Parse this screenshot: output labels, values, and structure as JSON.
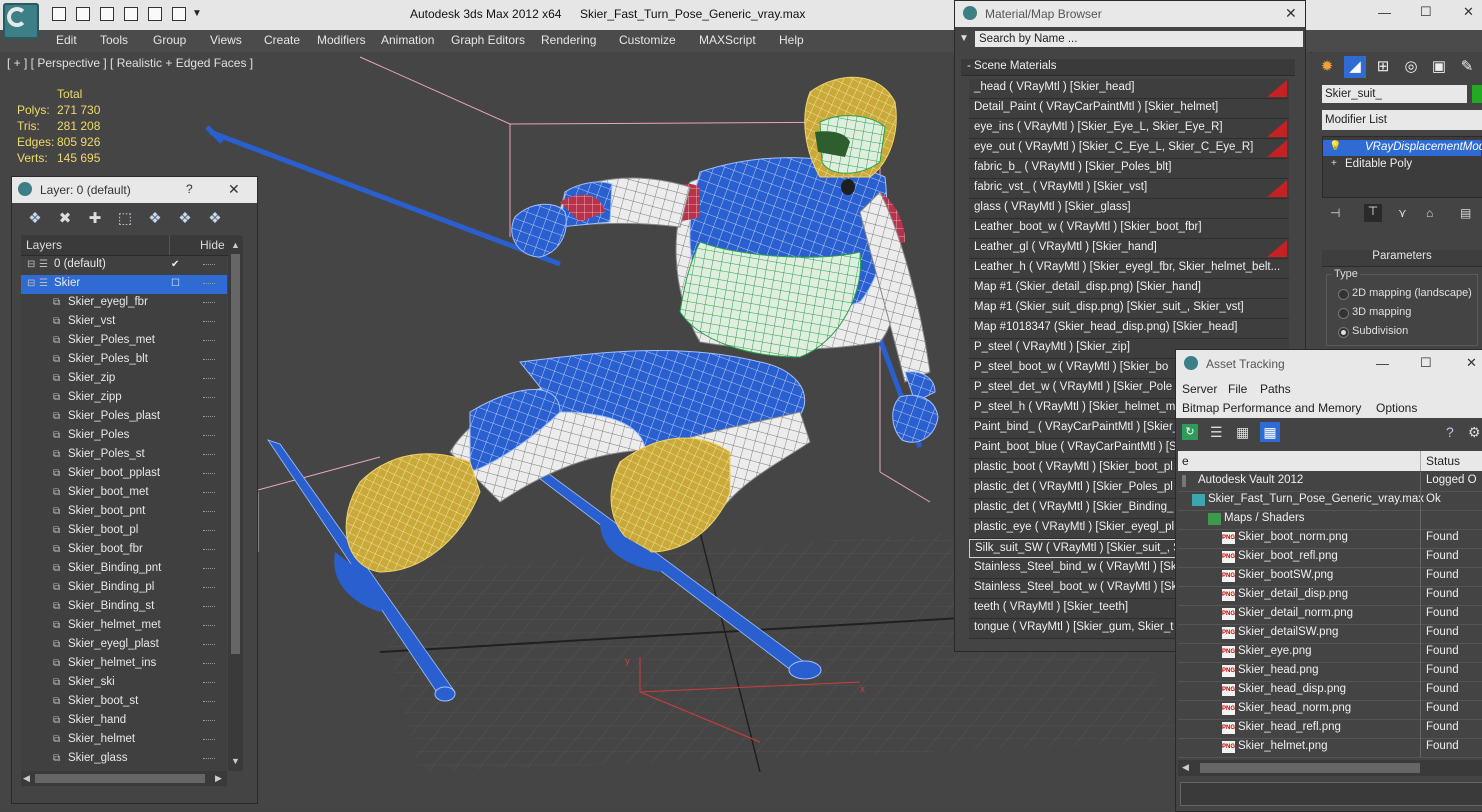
{
  "window": {
    "app_title": "Autodesk 3ds Max  2012 x64",
    "file_title": "Skier_Fast_Turn_Pose_Generic_vray.max"
  },
  "menu": [
    "Edit",
    "Tools",
    "Group",
    "Views",
    "Create",
    "Modifiers",
    "Animation",
    "Graph Editors",
    "Rendering",
    "Customize",
    "MAXScript",
    "Help"
  ],
  "viewport": {
    "label": "[ + ] [ Perspective ] [ Realistic + Edged Faces ]",
    "stats": {
      "header": "Total",
      "rows": [
        {
          "label": "Polys:",
          "value": "271 730"
        },
        {
          "label": "Tris:",
          "value": "281 208"
        },
        {
          "label": "Edges:",
          "value": "805 926"
        },
        {
          "label": "Verts:",
          "value": "145 695"
        }
      ]
    },
    "axis_x": "x",
    "axis_y": "y"
  },
  "layer_dialog": {
    "title": "Layer: 0 (default)",
    "help": "?",
    "close": "✕",
    "col_layers": "Layers",
    "col_hide": "Hide",
    "rows": [
      {
        "name": "0 (default)",
        "level": 1,
        "check": true
      },
      {
        "name": "Skier",
        "level": 1,
        "selected": true
      },
      {
        "name": "Skier_eyegl_fbr",
        "level": 2
      },
      {
        "name": "Skier_vst",
        "level": 2
      },
      {
        "name": "Skier_Poles_met",
        "level": 2
      },
      {
        "name": "Skier_Poles_blt",
        "level": 2
      },
      {
        "name": "Skier_zip",
        "level": 2
      },
      {
        "name": "Skier_zipp",
        "level": 2
      },
      {
        "name": "Skier_Poles_plast",
        "level": 2
      },
      {
        "name": "Skier_Poles",
        "level": 2
      },
      {
        "name": "Skier_Poles_st",
        "level": 2
      },
      {
        "name": "Skier_boot_pplast",
        "level": 2
      },
      {
        "name": "Skier_boot_met",
        "level": 2
      },
      {
        "name": "Skier_boot_pnt",
        "level": 2
      },
      {
        "name": "Skier_boot_pl",
        "level": 2
      },
      {
        "name": "Skier_boot_fbr",
        "level": 2
      },
      {
        "name": "Skier_Binding_pnt",
        "level": 2
      },
      {
        "name": "Skier_Binding_pl",
        "level": 2
      },
      {
        "name": "Skier_Binding_st",
        "level": 2
      },
      {
        "name": "Skier_helmet_met",
        "level": 2
      },
      {
        "name": "Skier_eyegl_plast",
        "level": 2
      },
      {
        "name": "Skier_helmet_ins",
        "level": 2
      },
      {
        "name": "Skier_ski",
        "level": 2
      },
      {
        "name": "Skier_boot_st",
        "level": 2
      },
      {
        "name": "Skier_hand",
        "level": 2
      },
      {
        "name": "Skier_helmet",
        "level": 2
      },
      {
        "name": "Skier_glass",
        "level": 2
      }
    ]
  },
  "material_browser": {
    "title": "Material/Map Browser",
    "close": "✕",
    "search_placeholder": "Search by Name ...",
    "group": "- Scene Materials",
    "rows": [
      {
        "text": "_head  ( VRayMtl ) [Skier_head]",
        "swatch": true
      },
      {
        "text": "Detail_Paint  ( VRayCarPaintMtl ) [Skier_helmet]",
        "swatch": false
      },
      {
        "text": "eye_ins  ( VRayMtl ) [Skier_Eye_L, Skier_Eye_R]",
        "swatch": true
      },
      {
        "text": "eye_out  ( VRayMtl ) [Skier_C_Eye_L, Skier_C_Eye_R]",
        "swatch": true
      },
      {
        "text": "fabric_b_  ( VRayMtl ) [Skier_Poles_blt]",
        "swatch": false
      },
      {
        "text": "fabric_vst_  ( VRayMtl ) [Skier_vst]",
        "swatch": true
      },
      {
        "text": "glass  ( VRayMtl ) [Skier_glass]",
        "swatch": false
      },
      {
        "text": "Leather_boot_w  ( VRayMtl ) [Skier_boot_fbr]",
        "swatch": false
      },
      {
        "text": "Leather_gl  ( VRayMtl ) [Skier_hand]",
        "swatch": true
      },
      {
        "text": "Leather_h  ( VRayMtl ) [Skier_eyegl_fbr, Skier_helmet_belt...",
        "swatch": false
      },
      {
        "text": "Map #1 (Skier_detail_disp.png) [Skier_hand]",
        "swatch": false
      },
      {
        "text": "Map #1 (Skier_suit_disp.png) [Skier_suit_, Skier_vst]",
        "swatch": false
      },
      {
        "text": "Map #1018347 (Skier_head_disp.png) [Skier_head]",
        "swatch": false
      },
      {
        "text": "P_steel  ( VRayMtl ) [Skier_zip]",
        "swatch": false
      },
      {
        "text": "P_steel_boot_w  ( VRayMtl ) [Skier_bo",
        "swatch": false
      },
      {
        "text": "P_steel_det_w  ( VRayMtl ) [Skier_Pole",
        "swatch": false
      },
      {
        "text": "P_steel_h  ( VRayMtl ) [Skier_helmet_m",
        "swatch": false
      },
      {
        "text": "Paint_bind_  ( VRayCarPaintMtl ) [Skier_",
        "swatch": false
      },
      {
        "text": "Paint_boot_blue  ( VRayCarPaintMtl ) [Sk",
        "swatch": false
      },
      {
        "text": "plastic_boot ( VRayMtl ) [Skier_boot_pl",
        "swatch": false
      },
      {
        "text": "plastic_det  ( VRayMtl ) [Skier_Poles_pl",
        "swatch": false
      },
      {
        "text": "plastic_det  ( VRayMtl ) [Skier_Binding_",
        "swatch": false
      },
      {
        "text": "plastic_eye  ( VRayMtl ) [Skier_eyegl_pl",
        "swatch": false
      },
      {
        "text": "Silk_suit_SW  ( VRayMtl ) [Skier_suit_, S",
        "swatch": false,
        "highlight": true
      },
      {
        "text": "Stainless_Steel_bind_w  ( VRayMtl ) [Sk",
        "swatch": false
      },
      {
        "text": "Stainless_Steel_boot_w  ( VRayMtl ) [Sk",
        "swatch": false
      },
      {
        "text": "teeth  ( VRayMtl ) [Skier_teeth]",
        "swatch": false
      },
      {
        "text": "tongue  ( VRayMtl ) [Skier_gum, Skier_t",
        "swatch": false
      }
    ]
  },
  "command_panel": {
    "object_name": "Skier_suit_",
    "modifier_list": "Modifier List",
    "stack": [
      {
        "name": "VRayDisplacementMod",
        "active": true
      },
      {
        "name": "Editable Poly",
        "active": false
      }
    ],
    "params_header": "Parameters",
    "type_label": "Type",
    "options": [
      {
        "label": "2D mapping (landscape)",
        "on": false
      },
      {
        "label": "3D mapping",
        "on": false
      },
      {
        "label": "Subdivision",
        "on": true
      }
    ]
  },
  "asset_tracking": {
    "title": "Asset Tracking",
    "menu_row1": [
      "Server",
      "File",
      "Paths"
    ],
    "menu_row2": [
      "Bitmap Performance and Memory",
      "Options"
    ],
    "col_name": "e",
    "col_status": "Status",
    "rows": [
      {
        "name": "Autodesk Vault 2012",
        "status": "Logged O",
        "level": 0,
        "icon": "vault"
      },
      {
        "name": "Skier_Fast_Turn_Pose_Generic_vray.max",
        "status": "Ok",
        "level": 1,
        "icon": "max"
      },
      {
        "name": "Maps / Shaders",
        "status": "",
        "level": 2,
        "icon": "maps"
      },
      {
        "name": "Skier_boot_norm.png",
        "status": "Found",
        "level": 3,
        "icon": "png"
      },
      {
        "name": "Skier_boot_refl.png",
        "status": "Found",
        "level": 3,
        "icon": "png"
      },
      {
        "name": "Skier_bootSW.png",
        "status": "Found",
        "level": 3,
        "icon": "png"
      },
      {
        "name": "Skier_detail_disp.png",
        "status": "Found",
        "level": 3,
        "icon": "png"
      },
      {
        "name": "Skier_detail_norm.png",
        "status": "Found",
        "level": 3,
        "icon": "png"
      },
      {
        "name": "Skier_detailSW.png",
        "status": "Found",
        "level": 3,
        "icon": "png"
      },
      {
        "name": "Skier_eye.png",
        "status": "Found",
        "level": 3,
        "icon": "png"
      },
      {
        "name": "Skier_head.png",
        "status": "Found",
        "level": 3,
        "icon": "png"
      },
      {
        "name": "Skier_head_disp.png",
        "status": "Found",
        "level": 3,
        "icon": "png"
      },
      {
        "name": "Skier_head_norm.png",
        "status": "Found",
        "level": 3,
        "icon": "png"
      },
      {
        "name": "Skier_head_refl.png",
        "status": "Found",
        "level": 3,
        "icon": "png"
      },
      {
        "name": "Skier_helmet.png",
        "status": "Found",
        "level": 3,
        "icon": "png"
      }
    ],
    "png_badge": "PNG"
  },
  "colors": {
    "selection": "#2f6bd2",
    "swatch_red": "#c82020",
    "stats_yellow": "#f0d96b",
    "suit_blue": "#2a5fd0",
    "suit_green": "#28a048",
    "helmet_yellow": "#e8c64a"
  }
}
